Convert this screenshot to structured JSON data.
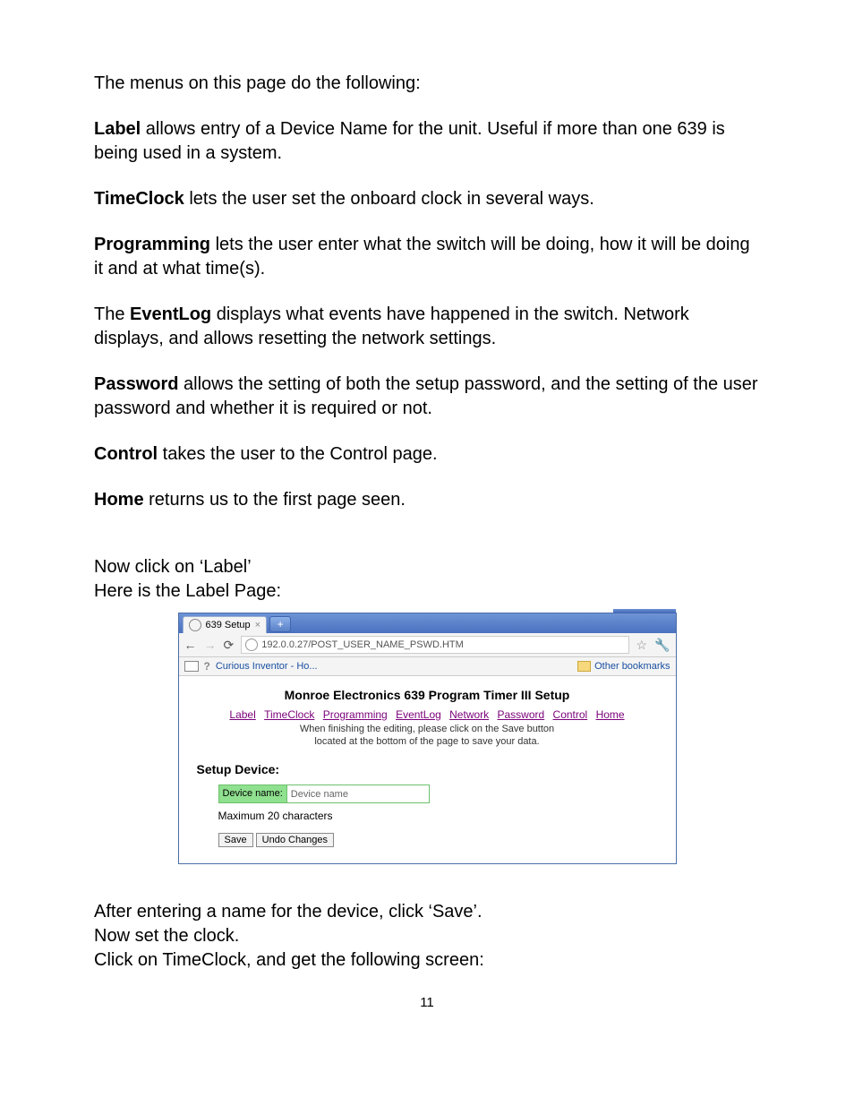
{
  "doc": {
    "intro": "The menus on this page do the following:",
    "label_bold": "Label",
    "label_rest": " allows entry of a Device Name for the unit.  Useful if more than one 639 is being used in a system.",
    "timeclock_bold": "TimeClock",
    "timeclock_rest": " lets the user set the onboard clock in several ways.",
    "programming_bold": "Programming",
    "programming_rest": " lets the user enter what the switch will be doing, how it will be doing it and at what time(s).",
    "eventlog_pre": "The ",
    "eventlog_bold": "EventLog",
    "eventlog_rest": " displays what events have happened in the switch. Network displays, and allows resetting the network settings.",
    "password_bold": "Password",
    "password_rest": " allows the setting of both the setup password, and the setting of the user password and whether it is required or not.",
    "control_bold": "Control",
    "control_rest": " takes the user to the Control page.",
    "home_bold": "Home",
    "home_rest": " returns us to the first page seen.",
    "now_click": "Now click on ‘Label’",
    "here_is": "Here is the Label Page:",
    "after1": "After entering a name for the device, click ‘Save’.",
    "after2": "Now set the clock.",
    "after3": "Click on TimeClock, and get the following screen:",
    "page_number": "11"
  },
  "browser": {
    "tab_title": "639 Setup",
    "new_tab": "+",
    "url": "192.0.0.27/POST_USER_NAME_PSWD.HTM",
    "bookmark_left": "Curious Inventor - Ho...",
    "bookmark_right": "Other bookmarks"
  },
  "web": {
    "title": "Monroe Electronics 639 Program Timer III Setup",
    "nav": {
      "label": "Label",
      "timeclock": "TimeClock",
      "programming": "Programming",
      "eventlog": "EventLog",
      "network": "Network",
      "password": "Password",
      "control": "Control",
      "home": "Home"
    },
    "subnote1": "When finishing the editing, please click on the Save button",
    "subnote2": "located at the bottom of the page to save your data.",
    "section": "Setup Device:",
    "device_label": "Device name:",
    "device_value": "Device name",
    "hint": "Maximum 20 characters",
    "save": "Save",
    "undo": "Undo Changes"
  }
}
